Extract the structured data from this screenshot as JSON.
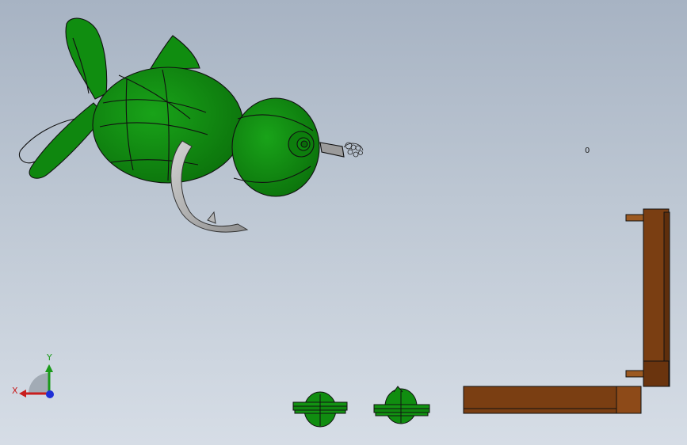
{
  "viewport": {
    "colors": {
      "part_green": "#0f8a0f",
      "part_green_dark": "#0b5e0b",
      "hook_gray": "#a9a9a9",
      "wood_brown": "#7a3e12",
      "wood_brown_light": "#8d4a18",
      "edge": "#1a1a1a"
    },
    "models": [
      {
        "name": "fish-lure-model"
      },
      {
        "name": "fishing-hook"
      },
      {
        "name": "wooden-bracket"
      },
      {
        "name": "small-part-left"
      },
      {
        "name": "small-part-right"
      }
    ],
    "origin_marker": "0"
  },
  "triad": {
    "x_label": "X",
    "y_label": "Y",
    "x_color": "#c81e1e",
    "y_color": "#1a9a1a",
    "z_color": "#1f2fd6"
  }
}
